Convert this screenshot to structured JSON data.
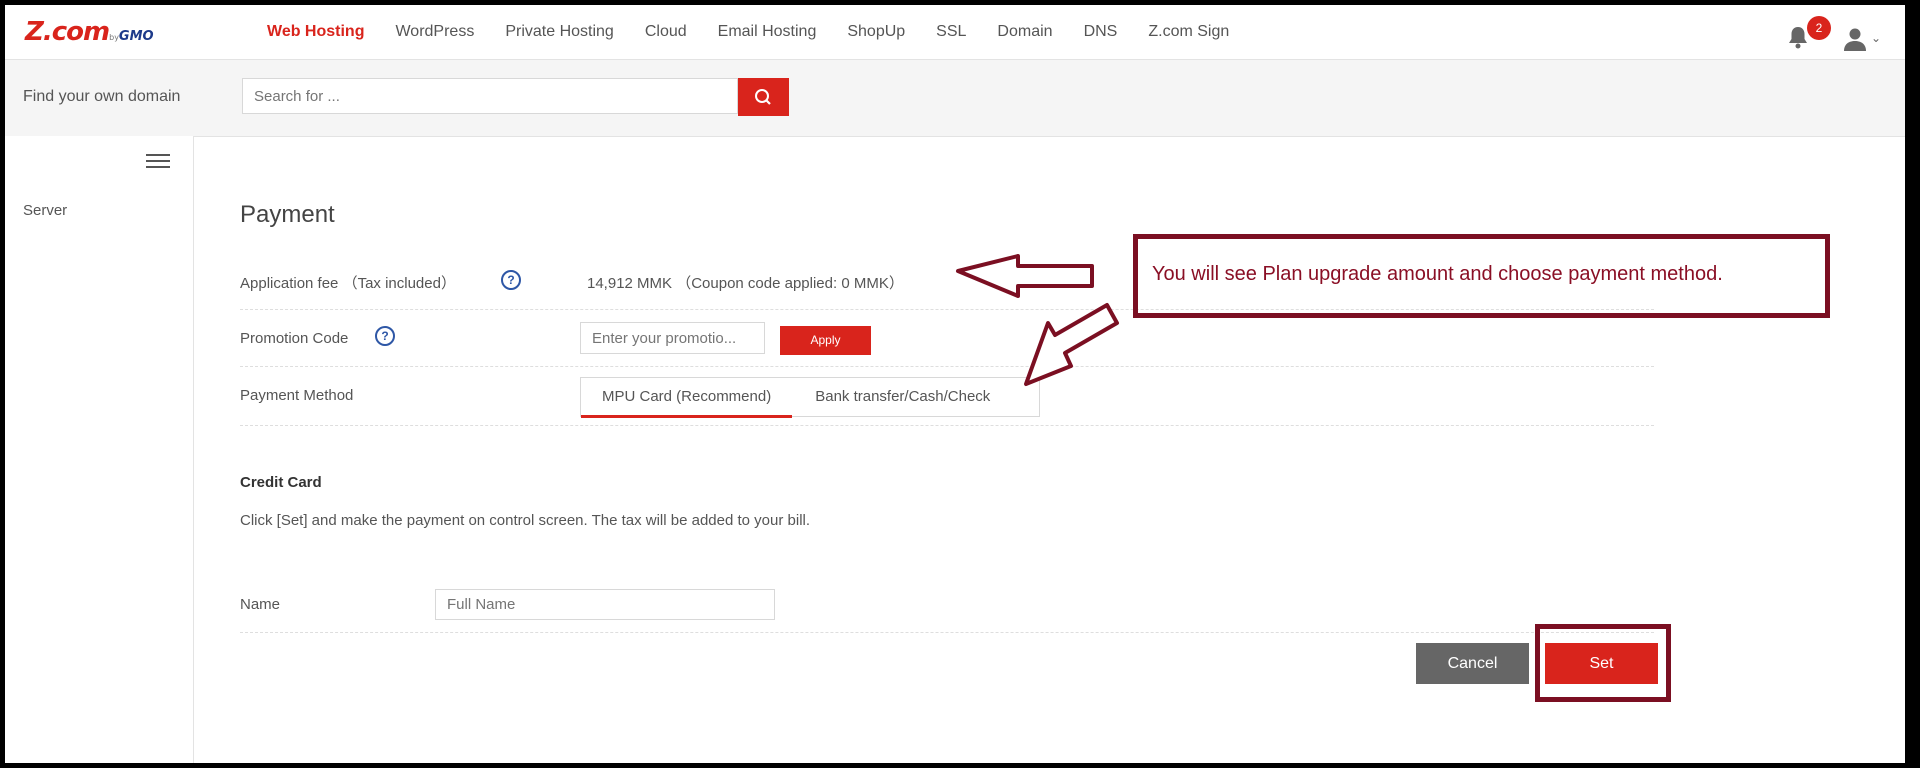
{
  "header": {
    "logo": "Z.com",
    "logo_by": "by",
    "logo_gmo": "GMO",
    "nav": [
      "Web Hosting",
      "WordPress",
      "Private Hosting",
      "Cloud",
      "Email Hosting",
      "ShopUp",
      "SSL",
      "Domain",
      "DNS",
      "Z.com Sign"
    ],
    "active_nav": "Web Hosting",
    "notification_count": "2"
  },
  "search": {
    "label": "Find your own domain",
    "placeholder": "Search for ..."
  },
  "sidebar": {
    "items": [
      "Server"
    ]
  },
  "payment": {
    "title": "Payment",
    "fee_label": "Application fee （Tax included）",
    "fee_value": "14,912 MMK （Coupon code applied:  0 MMK）",
    "promo_label": "Promotion Code",
    "promo_placeholder": "Enter your promotio...",
    "apply_label": "Apply",
    "method_label": "Payment Method",
    "tabs": [
      "MPU Card (Recommend)",
      "Bank transfer/Cash/Check"
    ],
    "active_tab": "MPU Card (Recommend)"
  },
  "credit_card": {
    "title": "Credit Card",
    "description": "Click [Set] and make the payment on control screen. The tax will be added to your bill.",
    "name_label": "Name",
    "name_placeholder": "Full Name"
  },
  "actions": {
    "cancel": "Cancel",
    "set": "Set"
  },
  "annotation": {
    "callout": "You will see Plan upgrade amount and choose payment method.",
    "color": "#7b0f22"
  },
  "colors": {
    "brand_red": "#d9241c",
    "help_blue": "#2e57a6"
  }
}
